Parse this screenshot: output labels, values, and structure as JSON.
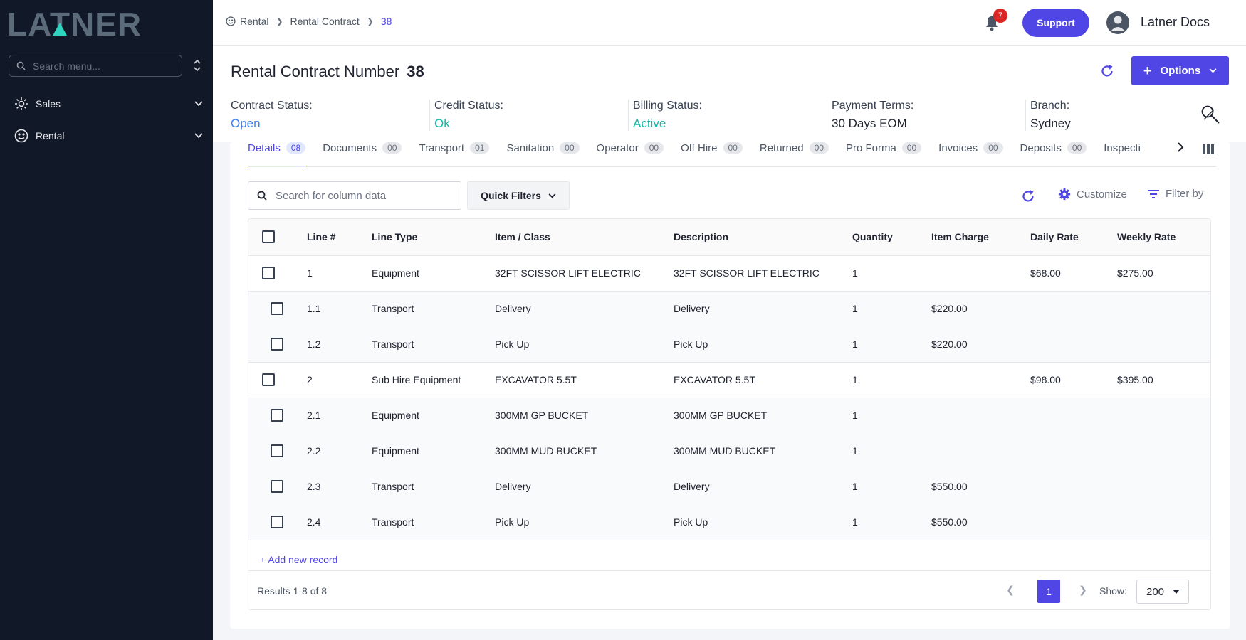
{
  "app": {
    "logo_text": "LATNER"
  },
  "sidebar": {
    "search_placeholder": "Search menu...",
    "items": [
      {
        "label": "Sales",
        "icon": "sales-icon"
      },
      {
        "label": "Rental",
        "icon": "rental-icon"
      }
    ]
  },
  "header": {
    "breadcrumb": [
      "Rental",
      "Rental Contract",
      "38"
    ],
    "notifications_count": "7",
    "support_label": "Support",
    "user_name": "Latner Docs"
  },
  "contract": {
    "title": "Rental Contract Number",
    "number": "38",
    "options_label": "Options",
    "status": [
      {
        "label": "Contract Status:",
        "value": "Open"
      },
      {
        "label": "Credit Status:",
        "value": "Ok"
      },
      {
        "label": "Billing Status:",
        "value": "Active"
      },
      {
        "label": "Payment Terms:",
        "value": "30 Days EOM"
      },
      {
        "label": "Branch:",
        "value": "Sydney"
      }
    ]
  },
  "tabs": [
    {
      "label": "Details",
      "count": "08"
    },
    {
      "label": "Documents",
      "count": "00"
    },
    {
      "label": "Transport",
      "count": "01"
    },
    {
      "label": "Sanitation",
      "count": "00"
    },
    {
      "label": "Operator",
      "count": "00"
    },
    {
      "label": "Off Hire",
      "count": "00"
    },
    {
      "label": "Returned",
      "count": "00"
    },
    {
      "label": "Pro Forma",
      "count": "00"
    },
    {
      "label": "Invoices",
      "count": "00"
    },
    {
      "label": "Deposits",
      "count": "00"
    },
    {
      "label": "Inspecti",
      "count": ""
    }
  ],
  "toolbar": {
    "search_placeholder": "Search for column data",
    "quick_filters_label": "Quick Filters",
    "customize_label": "Customize",
    "filter_label": "Filter by"
  },
  "table": {
    "headers": [
      "Line #",
      "Line Type",
      "Item / Class",
      "Description",
      "Quantity",
      "Item Charge",
      "Daily Rate",
      "Weekly Rate"
    ],
    "rows": [
      {
        "line": "1",
        "type": "Equipment",
        "item": "32FT SCISSOR LIFT ELECTRIC",
        "desc": "32FT SCISSOR LIFT ELECTRIC",
        "qty": "1",
        "charge": "",
        "daily": "$68.00",
        "weekly": "$275.00"
      },
      {
        "line": "1.1",
        "type": "Transport",
        "item": "Delivery",
        "desc": "Delivery",
        "qty": "1",
        "charge": "$220.00",
        "daily": "",
        "weekly": ""
      },
      {
        "line": "1.2",
        "type": "Transport",
        "item": "Pick Up",
        "desc": "Pick Up",
        "qty": "1",
        "charge": "$220.00",
        "daily": "",
        "weekly": ""
      },
      {
        "line": "2",
        "type": "Sub Hire Equipment",
        "item": "EXCAVATOR 5.5T",
        "desc": "EXCAVATOR 5.5T",
        "qty": "1",
        "charge": "",
        "daily": "$98.00",
        "weekly": "$395.00"
      },
      {
        "line": "2.1",
        "type": "Equipment",
        "item": "300MM GP BUCKET",
        "desc": "300MM GP BUCKET",
        "qty": "1",
        "charge": "",
        "daily": "",
        "weekly": ""
      },
      {
        "line": "2.2",
        "type": "Equipment",
        "item": "300MM MUD BUCKET",
        "desc": "300MM MUD BUCKET",
        "qty": "1",
        "charge": "",
        "daily": "",
        "weekly": ""
      },
      {
        "line": "2.3",
        "type": "Transport",
        "item": "Delivery",
        "desc": "Delivery",
        "qty": "1",
        "charge": "$550.00",
        "daily": "",
        "weekly": ""
      },
      {
        "line": "2.4",
        "type": "Transport",
        "item": "Pick Up",
        "desc": "Pick Up",
        "qty": "1",
        "charge": "$550.00",
        "daily": "",
        "weekly": ""
      }
    ]
  },
  "footer": {
    "add_record_label": "+ Add new record",
    "results_text": "Results 1-8 of 8",
    "current_page": "1",
    "show_label": "Show:",
    "show_value": "200"
  },
  "colors": {
    "accent": "#4f46e5",
    "sidebar_bg": "#111827",
    "open": "#3b82f6",
    "ok": "#14b8a6"
  }
}
